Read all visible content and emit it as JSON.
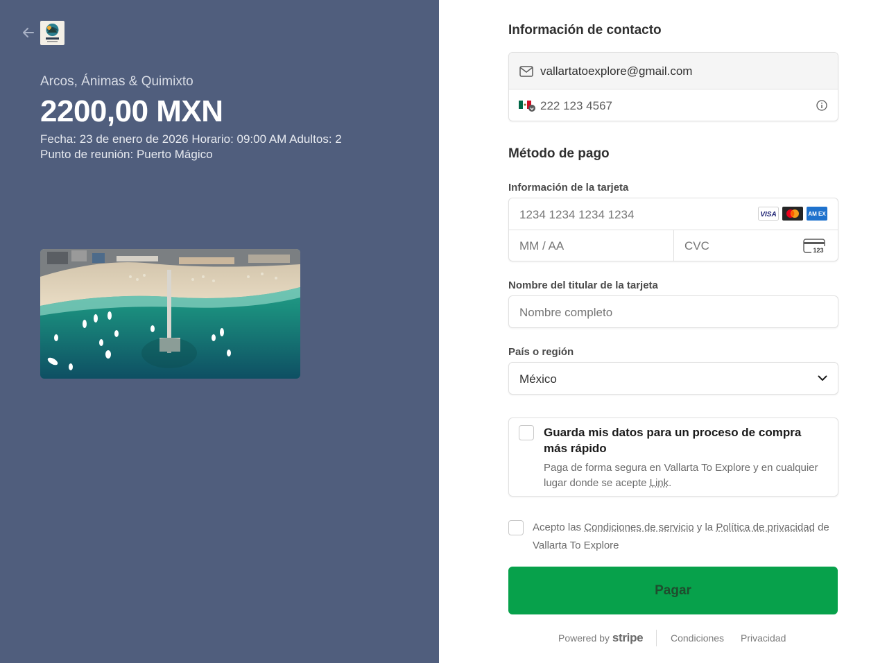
{
  "summary": {
    "product_name": "Arcos, Ánimas & Quimixto",
    "price": "2200,00 MXN",
    "details_line1": "Fecha: 23 de enero de 2026 Horario: 09:00 AM Adultos: 2",
    "details_line2": "Punto de reunión: Puerto Mágico",
    "logo_text": "VALLARTA TO EXPLORE"
  },
  "contact": {
    "title": "Información de contacto",
    "email": "vallartatoexplore@gmail.com",
    "phone": "222 123 4567"
  },
  "payment": {
    "title": "Método de pago",
    "card_label": "Información de la tarjeta",
    "card_number_placeholder": "1234 1234 1234 1234",
    "expiry_placeholder": "MM / AA",
    "cvc_placeholder": "CVC",
    "cvc_icon_text": "123",
    "brands": [
      "VISA",
      "AM EX"
    ],
    "cardholder_label": "Nombre del titular de la tarjeta",
    "cardholder_placeholder": "Nombre completo",
    "country_label": "País o región",
    "country_value": "México"
  },
  "save_info": {
    "title": "Guarda mis datos para un proceso de compra más rápido",
    "subtitle_prefix": "Paga de forma segura en Vallarta To Explore y en cualquier lugar donde se acepte ",
    "link": "Link",
    "subtitle_suffix": "."
  },
  "terms": {
    "prefix": "Acepto las ",
    "terms_link": "Condiciones de servicio",
    "middle": " y la ",
    "privacy_link": "Política de privacidad",
    "suffix": " de Vallarta To Explore"
  },
  "pay_button": "Pagar",
  "footer": {
    "powered_by": "Powered by",
    "stripe": "stripe",
    "conditions": "Condiciones",
    "privacy": "Privacidad"
  },
  "colors": {
    "left_panel": "#505e7d",
    "pay_button": "#07a14b",
    "mastercard_red": "#eb001b",
    "mastercard_orange": "#f79e1b",
    "amex_blue": "#1f72cd",
    "visa_blue": "#1a1f71"
  },
  "icons": [
    "back-arrow-icon",
    "envelope-icon",
    "mexico-flag-icon",
    "info-icon",
    "cvc-card-icon",
    "chevron-down-icon"
  ]
}
